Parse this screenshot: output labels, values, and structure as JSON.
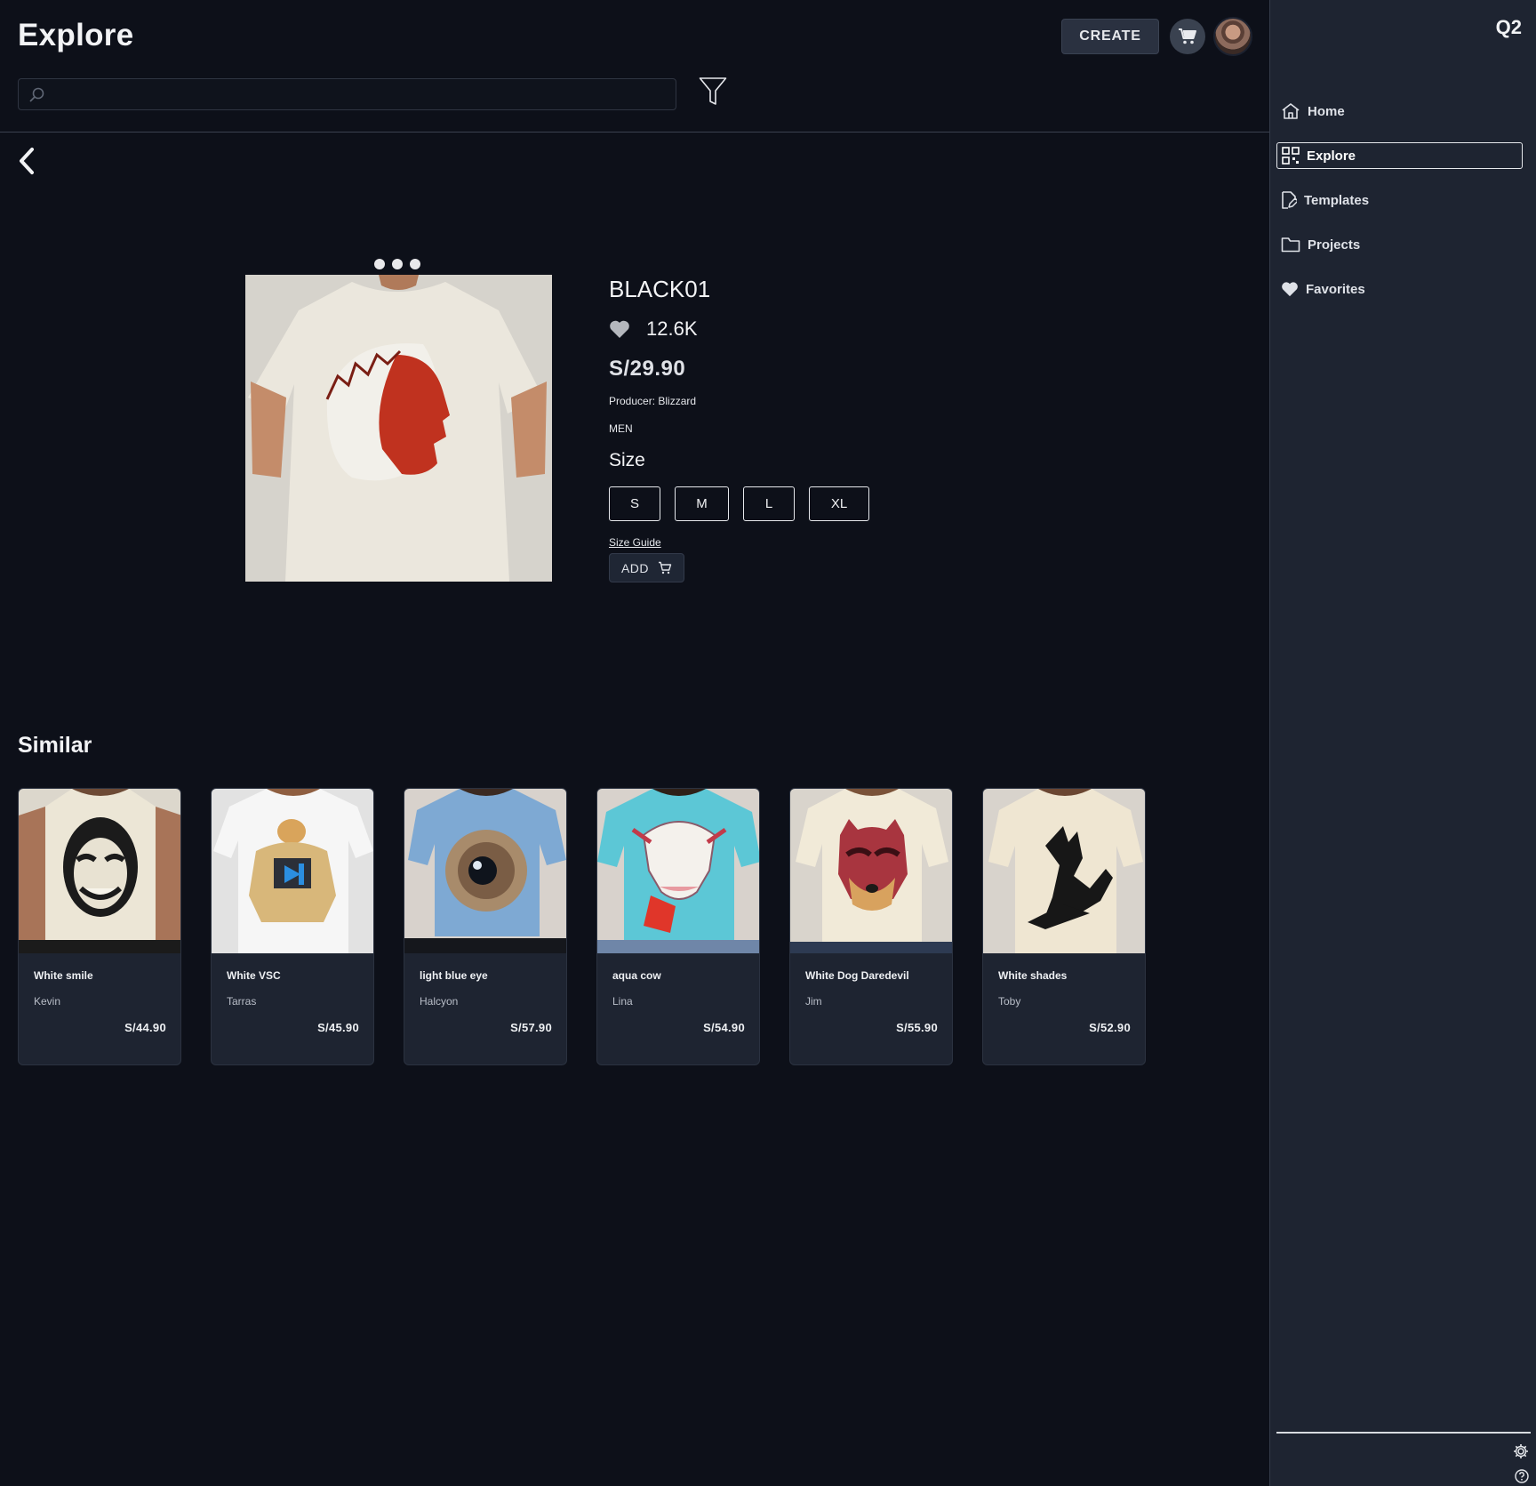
{
  "header": {
    "title": "Explore",
    "create_label": "CREATE",
    "search_placeholder": ""
  },
  "product": {
    "name": "BLACK01",
    "likes": "12.6K",
    "price": "S/29.90",
    "producer": "Producer: Blizzard",
    "gender": "MEN",
    "size_title": "Size",
    "sizes": [
      "S",
      "M",
      "L",
      "XL"
    ],
    "size_guide": "Size Guide",
    "add_label": "ADD",
    "image_count": 3
  },
  "similar": {
    "title": "Similar",
    "items": [
      {
        "title": "White smile",
        "author": "Kevin",
        "price": "S/44.90"
      },
      {
        "title": "White VSC",
        "author": "Tarras",
        "price": "S/45.90"
      },
      {
        "title": "light blue eye",
        "author": "Halcyon",
        "price": "S/57.90"
      },
      {
        "title": "aqua cow",
        "author": "Lina",
        "price": "S/54.90"
      },
      {
        "title": "White Dog Daredevil",
        "author": "Jim",
        "price": "S/55.90"
      },
      {
        "title": "White shades",
        "author": "Toby",
        "price": "S/52.90"
      }
    ]
  },
  "sidebar": {
    "brand": "Q2",
    "items": [
      {
        "label": "Home",
        "icon": "home-icon"
      },
      {
        "label": "Explore",
        "icon": "grid-icon",
        "active": true
      },
      {
        "label": "Templates",
        "icon": "template-icon"
      },
      {
        "label": "Projects",
        "icon": "folder-icon"
      },
      {
        "label": "Favorites",
        "icon": "heart-icon"
      }
    ]
  },
  "colors": {
    "background": "#0d1019",
    "sidebar": "#1e2431",
    "card": "#1e2431",
    "accent_text": "#f2f3f5"
  }
}
